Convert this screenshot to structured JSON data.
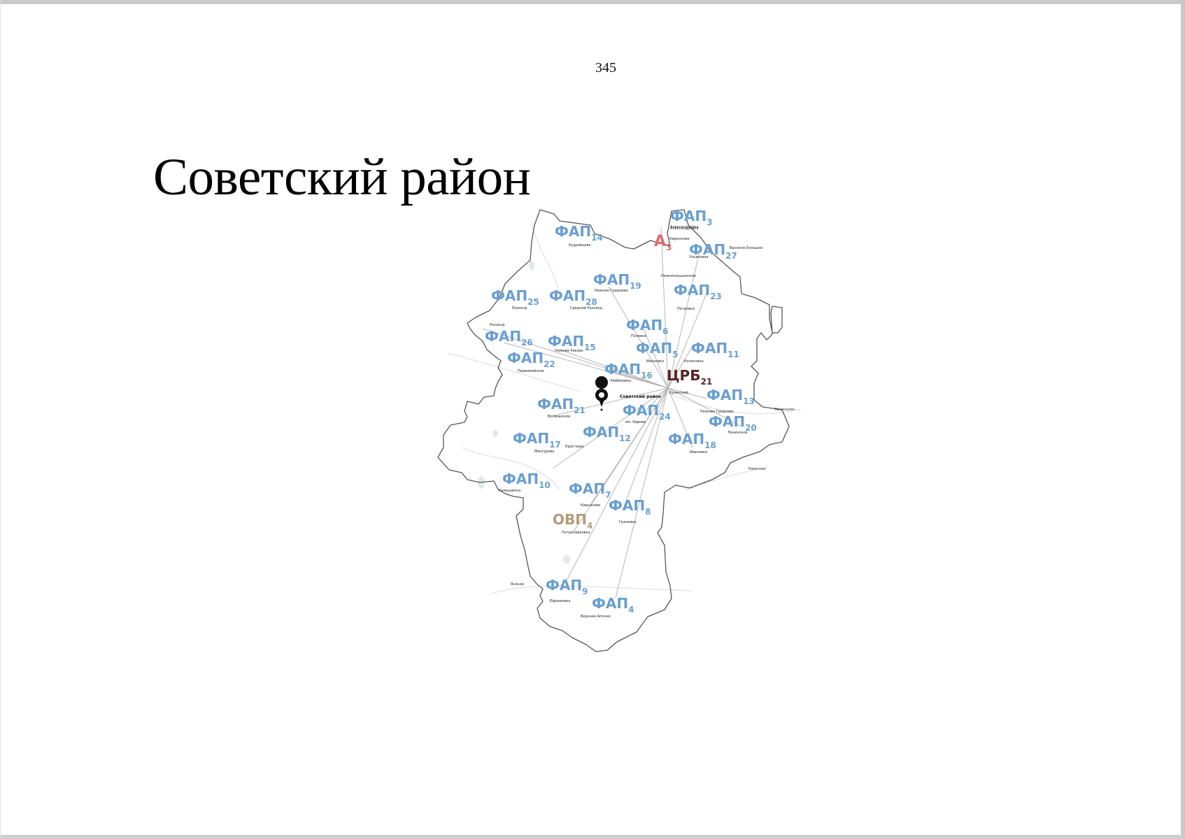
{
  "page_number": "345",
  "title": "Советский район",
  "colors": {
    "fap": "#6a9fd0",
    "crb": "#5a2424",
    "ovp": "#b59a7a",
    "ambulance": "#e06a6a",
    "border": "#555555",
    "routes": "#b5b5b5"
  },
  "map": {
    "center_marker_icon": "location-pin-icon",
    "center_marker_label": "Советский район",
    "facilities": [
      {
        "type": "ФАП",
        "num": "14",
        "village": "Кудрявцево"
      },
      {
        "type": "ФАП",
        "num": "3",
        "village": "Александровка"
      },
      {
        "type": "А",
        "num": "3",
        "village": "Кириллово"
      },
      {
        "type": "ФАП",
        "num": "27",
        "village": "Ульяновка"
      },
      {
        "type": "ФАП",
        "num": "19",
        "village": "Нижнее Гриднево"
      },
      {
        "type": "ФАП",
        "num": "25",
        "village": "Разъезд"
      },
      {
        "type": "ФАП",
        "num": "28",
        "village": "Средний Разъезд"
      },
      {
        "type": "ФАП",
        "num": "23",
        "village": "Петровка"
      },
      {
        "type": "ФАП",
        "num": "6",
        "village": "Полевое"
      },
      {
        "type": "ФАП",
        "num": "26",
        "village": "Разъезд"
      },
      {
        "type": "ФАП",
        "num": "15",
        "village": "Нижнее Раково"
      },
      {
        "type": "ФАП",
        "num": "5",
        "village": "Ивановка"
      },
      {
        "type": "ФАП",
        "num": "11",
        "village": "Колосовка"
      },
      {
        "type": "ФАП",
        "num": "22",
        "village": "Первомайское"
      },
      {
        "type": "ФАП",
        "num": "16",
        "village": "Любимовка"
      },
      {
        "type": "ЦРБ",
        "num": "21",
        "village": "Кшенский"
      },
      {
        "type": "ФАП",
        "num": "13",
        "village": "Нижнее Гриднево"
      },
      {
        "type": "ФАП",
        "num": "21",
        "village": "Волжанское"
      },
      {
        "type": "ФАП",
        "num": "24",
        "village": "им. Кирова"
      },
      {
        "type": "ФАП",
        "num": "20",
        "village": "Ленинское"
      },
      {
        "type": "ФАП",
        "num": "17",
        "village": "Мансурово"
      },
      {
        "type": "ФАП",
        "num": "12",
        "village": "Крестище"
      },
      {
        "type": "ФАП",
        "num": "18",
        "village": "Ивановка"
      },
      {
        "type": "ФАП",
        "num": "10",
        "village": "Камышенка"
      },
      {
        "type": "ФАП",
        "num": "7",
        "village": "Кирьяново"
      },
      {
        "type": "ФАП",
        "num": "8",
        "village": "Грачевка"
      },
      {
        "type": "ОВП",
        "num": "4",
        "village": "Петропавловка"
      },
      {
        "type": "ФАП",
        "num": "9",
        "village": "Ефремовка"
      },
      {
        "type": "ФАП",
        "num": "4",
        "village": "Верхнее Апочки"
      }
    ],
    "extra_places": [
      "Высокое Большое",
      "Александровка",
      "Ленинское",
      "Ракитное",
      "Ясенки",
      "Нижнеольшанское"
    ]
  }
}
